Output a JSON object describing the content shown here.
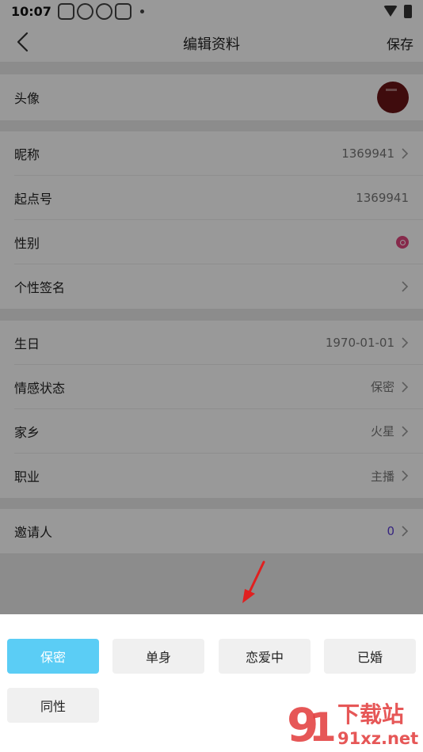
{
  "status_bar": {
    "time": "10:07"
  },
  "header": {
    "title": "编辑资料",
    "save_label": "保存"
  },
  "profile": {
    "avatar_label": "头像",
    "nickname": {
      "label": "昵称",
      "value": "1369941"
    },
    "qidian_id": {
      "label": "起点号",
      "value": "1369941"
    },
    "gender": {
      "label": "性别"
    },
    "signature": {
      "label": "个性签名"
    },
    "birthday": {
      "label": "生日",
      "value": "1970-01-01"
    },
    "relationship": {
      "label": "情感状态",
      "value": "保密"
    },
    "hometown": {
      "label": "家乡",
      "value": "火星"
    },
    "occupation": {
      "label": "职业",
      "value": "主播"
    },
    "inviter": {
      "label": "邀请人",
      "value": "0"
    }
  },
  "sheet": {
    "options": [
      "保密",
      "单身",
      "恋爱中",
      "已婚",
      "同性"
    ],
    "selected": "保密"
  },
  "watermark": {
    "line1": "下载站",
    "line2": "91xz.net"
  },
  "colors": {
    "accent": "#5bcdf5",
    "gender": "#e0477e",
    "invite": "#5b3fd6"
  }
}
